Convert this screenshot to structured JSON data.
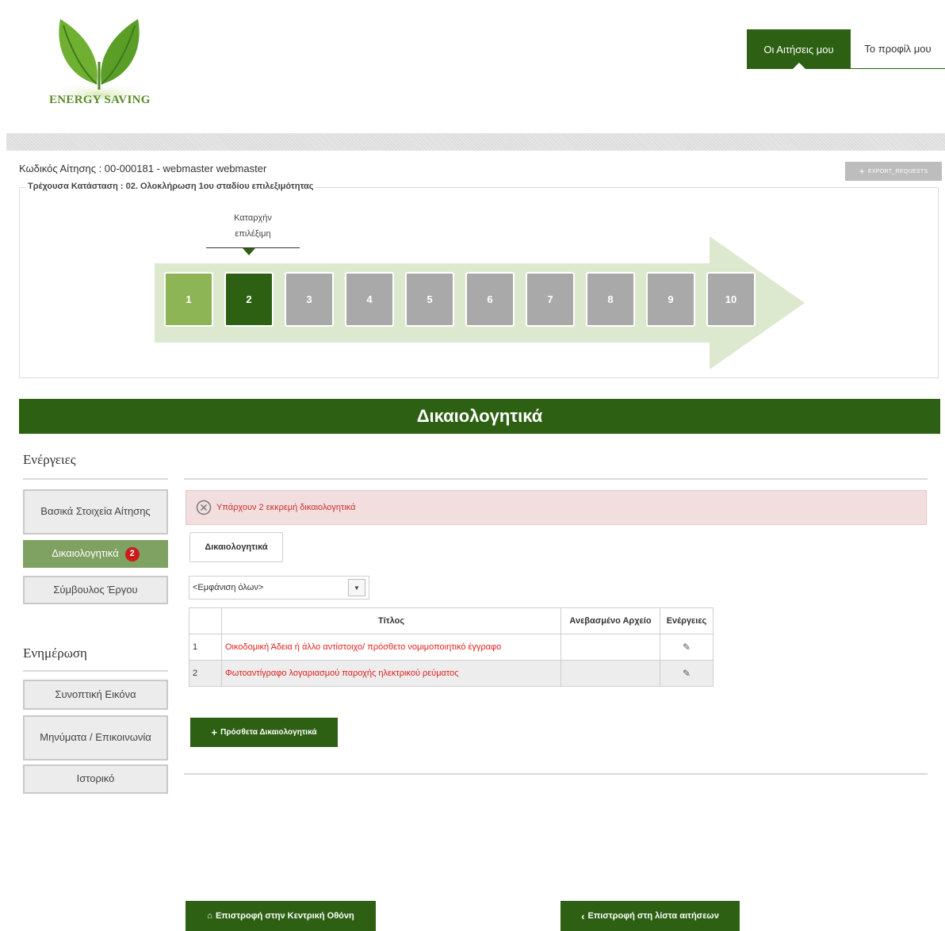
{
  "header": {
    "logo_text": "ENERGY SAVING",
    "nav": [
      {
        "label": "Οι Αιτήσεις μου",
        "active": true
      },
      {
        "label": "Το προφίλ μου",
        "active": false
      }
    ]
  },
  "application": {
    "code_line": "Κωδικός Αίτησης : 00-000181 - webmaster webmaster",
    "status_line": "Τρέχουσα Κατάσταση : 02. Ολοκλήρωση 1ου σταδίου επιλεξιμότητας",
    "export_label": "EXPORT_REQUESTS",
    "stage_label_line1": "Καταρχήν",
    "stage_label_line2": "επιλέξιμη",
    "steps": [
      "1",
      "2",
      "3",
      "4",
      "5",
      "6",
      "7",
      "8",
      "9",
      "10"
    ],
    "colors": {
      "done": "#8db556",
      "current": "#2e6013",
      "pending": "#a9a9a9"
    }
  },
  "section": {
    "title": "Δικαιολογητικά"
  },
  "sidebar": {
    "actions_title": "Ενέργειες",
    "actions": [
      {
        "label": "Βασικά Στοιχεία Αίτησης"
      },
      {
        "label": "Δικαιολογητικά",
        "badge": "2"
      },
      {
        "label": "Σύμβουλος Έργου"
      }
    ],
    "info_title": "Ενημέρωση",
    "info": [
      {
        "label": "Συνοπτική Εικόνα"
      },
      {
        "label": "Μηνύματα / Επικοινωνία"
      },
      {
        "label": "Ιστορικό"
      }
    ]
  },
  "main": {
    "alert_text": "Υπάρχουν 2 εκκρεμή δικαιολογητικά",
    "tab_label": "Δικαιολογητικά",
    "filter_value": "<Εμφάνιση όλων>",
    "table": {
      "headers": [
        "",
        "Τίτλος",
        "Ανεβασμένο Αρχείο",
        "Ενέργειες"
      ],
      "rows": [
        {
          "num": "1",
          "title": "Οικοδομική Άδεια ή άλλο αντίστοιχο/ πρόσθετο νομιμοποιητικό έγγραφο",
          "file": ""
        },
        {
          "num": "2",
          "title": "Φωτοαντίγραφο λογαριασμού παροχής ηλεκτρικού ρεύματος",
          "file": ""
        }
      ]
    },
    "add_button": "Πρόσθετα Δικαιολογητικά"
  },
  "footer": {
    "home_button": "Επιστροφή στην Κεντρική Οθόνη",
    "list_button": "Επιστροφή στη λίστα αιτήσεων"
  }
}
